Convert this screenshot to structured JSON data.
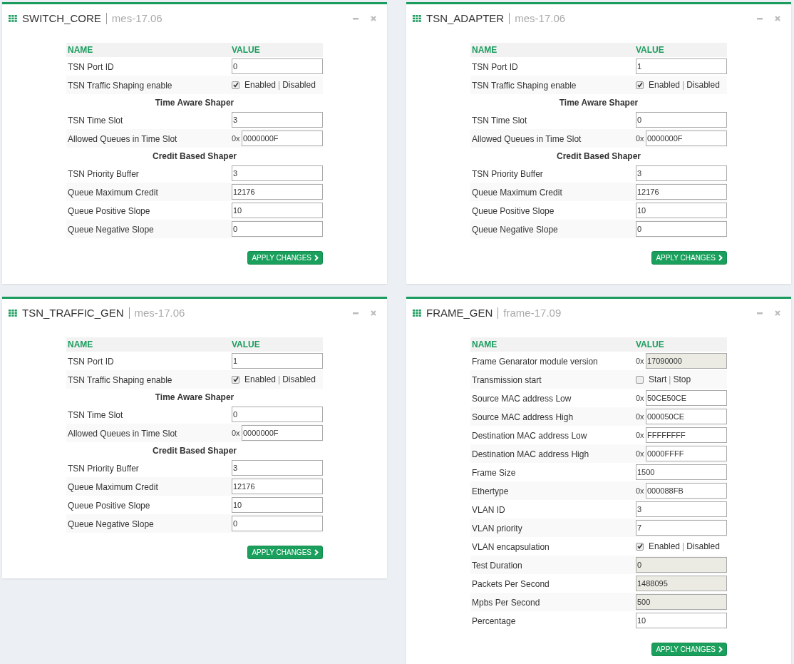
{
  "panels": [
    {
      "title": "SWITCH_CORE",
      "version": "mes-17.06",
      "columns": [
        "NAME",
        "VALUE"
      ],
      "rows": [
        {
          "kind": "input",
          "name": "TSN Port ID",
          "value": "0",
          "disabled": false
        },
        {
          "kind": "toggle",
          "name": "TSN Traffic Shaping enable",
          "checked": true,
          "on_label": "Enabled",
          "separator": "|",
          "off_label": "Disabled"
        },
        {
          "kind": "section",
          "name": "Time Aware Shaper"
        },
        {
          "kind": "input",
          "name": "TSN Time Slot",
          "value": "3",
          "disabled": false
        },
        {
          "kind": "input",
          "name": "Allowed Queues in Time Slot",
          "prefix": "0x",
          "value": "0000000F",
          "disabled": false
        },
        {
          "kind": "section",
          "name": "Credit Based Shaper"
        },
        {
          "kind": "input",
          "name": "TSN Priority Buffer",
          "value": "3",
          "disabled": false
        },
        {
          "kind": "input",
          "name": "Queue Maximum Credit",
          "value": "12176",
          "disabled": false
        },
        {
          "kind": "input",
          "name": "Queue Positive Slope",
          "value": "10",
          "disabled": false
        },
        {
          "kind": "input",
          "name": "Queue Negative Slope",
          "value": "0",
          "disabled": false
        }
      ],
      "button": "APPLY CHANGES"
    },
    {
      "title": "TSN_ADAPTER",
      "version": "mes-17.06",
      "columns": [
        "NAME",
        "VALUE"
      ],
      "rows": [
        {
          "kind": "input",
          "name": "TSN Port ID",
          "value": "1",
          "disabled": false
        },
        {
          "kind": "toggle",
          "name": "TSN Traffic Shaping enable",
          "checked": true,
          "on_label": "Enabled",
          "separator": "|",
          "off_label": "Disabled"
        },
        {
          "kind": "section",
          "name": "Time Aware Shaper"
        },
        {
          "kind": "input",
          "name": "TSN Time Slot",
          "value": "0",
          "disabled": false
        },
        {
          "kind": "input",
          "name": "Allowed Queues in Time Slot",
          "prefix": "0x",
          "value": "0000000F",
          "disabled": false
        },
        {
          "kind": "section",
          "name": "Credit Based Shaper"
        },
        {
          "kind": "input",
          "name": "TSN Priority Buffer",
          "value": "3",
          "disabled": false
        },
        {
          "kind": "input",
          "name": "Queue Maximum Credit",
          "value": "12176",
          "disabled": false
        },
        {
          "kind": "input",
          "name": "Queue Positive Slope",
          "value": "10",
          "disabled": false
        },
        {
          "kind": "input",
          "name": "Queue Negative Slope",
          "value": "0",
          "disabled": false
        }
      ],
      "button": "APPLY CHANGES"
    },
    {
      "title": "TSN_TRAFFIC_GEN",
      "version": "mes-17.06",
      "columns": [
        "NAME",
        "VALUE"
      ],
      "rows": [
        {
          "kind": "input",
          "name": "TSN Port ID",
          "value": "1",
          "disabled": false
        },
        {
          "kind": "toggle",
          "name": "TSN Traffic Shaping enable",
          "checked": true,
          "on_label": "Enabled",
          "separator": "|",
          "off_label": "Disabled"
        },
        {
          "kind": "section",
          "name": "Time Aware Shaper"
        },
        {
          "kind": "input",
          "name": "TSN Time Slot",
          "value": "0",
          "disabled": false
        },
        {
          "kind": "input",
          "name": "Allowed Queues in Time Slot",
          "prefix": "0x",
          "value": "0000000F",
          "disabled": false
        },
        {
          "kind": "section",
          "name": "Credit Based Shaper"
        },
        {
          "kind": "input",
          "name": "TSN Priority Buffer",
          "value": "3",
          "disabled": false
        },
        {
          "kind": "input",
          "name": "Queue Maximum Credit",
          "value": "12176",
          "disabled": false
        },
        {
          "kind": "input",
          "name": "Queue Positive Slope",
          "value": "10",
          "disabled": false
        },
        {
          "kind": "input",
          "name": "Queue Negative Slope",
          "value": "0",
          "disabled": false
        }
      ],
      "button": "APPLY CHANGES"
    },
    {
      "title": "FRAME_GEN",
      "version": "frame-17.09",
      "columns": [
        "NAME",
        "VALUE"
      ],
      "rows": [
        {
          "kind": "input",
          "name": "Frame Genarator module version",
          "prefix": "0x",
          "value": "17090000",
          "disabled": true
        },
        {
          "kind": "toggle",
          "name": "Transmission start",
          "checked": false,
          "on_label": "Start",
          "separator": "|",
          "off_label": "Stop"
        },
        {
          "kind": "input",
          "name": "Source MAC address Low",
          "prefix": "0x",
          "value": "50CE50CE",
          "disabled": false
        },
        {
          "kind": "input",
          "name": "Source MAC address High",
          "prefix": "0x",
          "value": "000050CE",
          "disabled": false
        },
        {
          "kind": "input",
          "name": "Destination MAC address Low",
          "prefix": "0x",
          "value": "FFFFFFFF",
          "disabled": false
        },
        {
          "kind": "input",
          "name": "Destination MAC address High",
          "prefix": "0x",
          "value": "0000FFFF",
          "disabled": false
        },
        {
          "kind": "input",
          "name": "Frame Size",
          "value": "1500",
          "disabled": false
        },
        {
          "kind": "input",
          "name": "Ethertype",
          "prefix": "0x",
          "value": "000088FB",
          "disabled": false
        },
        {
          "kind": "input",
          "name": "VLAN ID",
          "value": "3",
          "disabled": false
        },
        {
          "kind": "input",
          "name": "VLAN priority",
          "value": "7",
          "disabled": false
        },
        {
          "kind": "toggle",
          "name": "VLAN encapsulation",
          "checked": true,
          "on_label": "Enabled",
          "separator": "|",
          "off_label": "Disabled"
        },
        {
          "kind": "input",
          "name": "Test Duration",
          "value": "0",
          "disabled": true
        },
        {
          "kind": "input",
          "name": "Packets Per Second",
          "value": "1488095",
          "disabled": true
        },
        {
          "kind": "input",
          "name": "Mpbs Per Second",
          "value": "500",
          "disabled": true
        },
        {
          "kind": "input",
          "name": "Percentage",
          "value": "10",
          "disabled": false
        }
      ],
      "button": "APPLY CHANGES"
    }
  ]
}
